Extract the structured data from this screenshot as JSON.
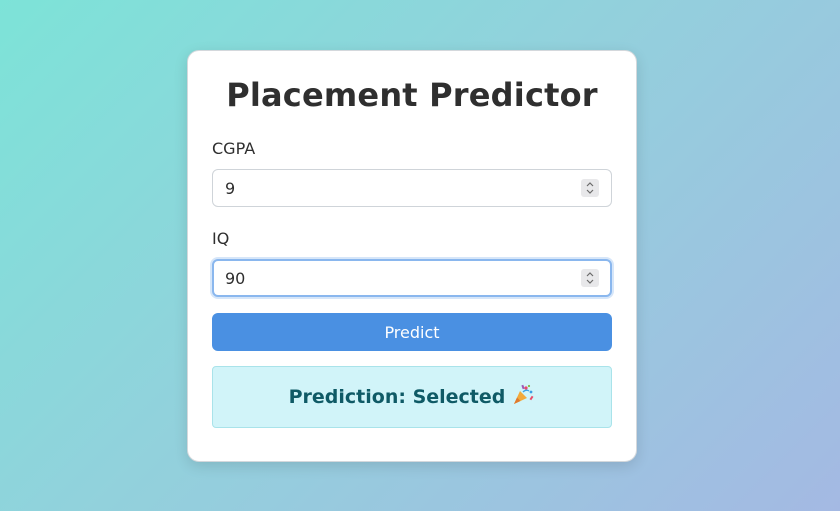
{
  "app": {
    "title": "Placement Predictor"
  },
  "form": {
    "cgpa": {
      "label": "CGPA",
      "value": "9"
    },
    "iq": {
      "label": "IQ",
      "value": "90"
    },
    "submit_label": "Predict"
  },
  "result": {
    "text": "Prediction: Selected",
    "icon": "party-popper-icon"
  },
  "colors": {
    "primary": "#4a90e2",
    "result_bg": "#d1f4f9",
    "result_text": "#0f5a66",
    "focus_ring": "#8ab7ee"
  }
}
